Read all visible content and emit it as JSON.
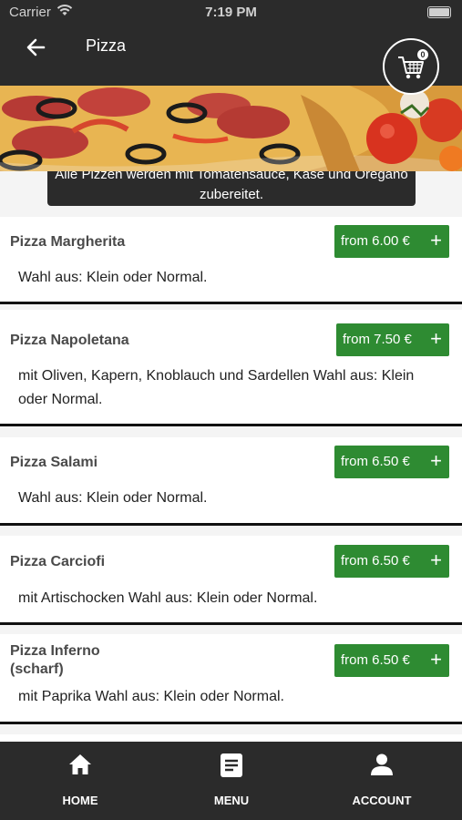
{
  "status_bar": {
    "carrier": "Carrier",
    "time": "7:19 PM"
  },
  "header": {
    "title": "Pizza",
    "cart_count": "0"
  },
  "notice": "Alle Pizzen werden mit Tomatensauce, Käse und Oregano zubereitet.",
  "items": [
    {
      "name": "Pizza Margherita",
      "price": "from 6.00 €",
      "description": "Wahl aus: Klein oder Normal."
    },
    {
      "name": "Pizza Napoletana",
      "price": "from 7.50 €",
      "description": "mit Oliven, Kapern, Knoblauch und Sardellen  Wahl aus: Klein oder Normal."
    },
    {
      "name": "Pizza Salami",
      "price": "from 6.50 €",
      "description": "Wahl aus: Klein oder Normal."
    },
    {
      "name": "Pizza Carciofi",
      "price": "from 6.50 €",
      "description": "mit Artischocken  Wahl aus: Klein oder Normal."
    },
    {
      "name": "Pizza Inferno (scharf)",
      "price": "from 6.50 €",
      "description": "mit Paprika  Wahl aus: Klein oder Normal."
    }
  ],
  "tabs": [
    {
      "label": "HOME",
      "icon": "home-icon"
    },
    {
      "label": "MENU",
      "icon": "menu-icon"
    },
    {
      "label": "ACCOUNT",
      "icon": "account-icon"
    }
  ],
  "colors": {
    "accent_green": "#2e8b32",
    "dark_bg": "#2b2b2b"
  }
}
